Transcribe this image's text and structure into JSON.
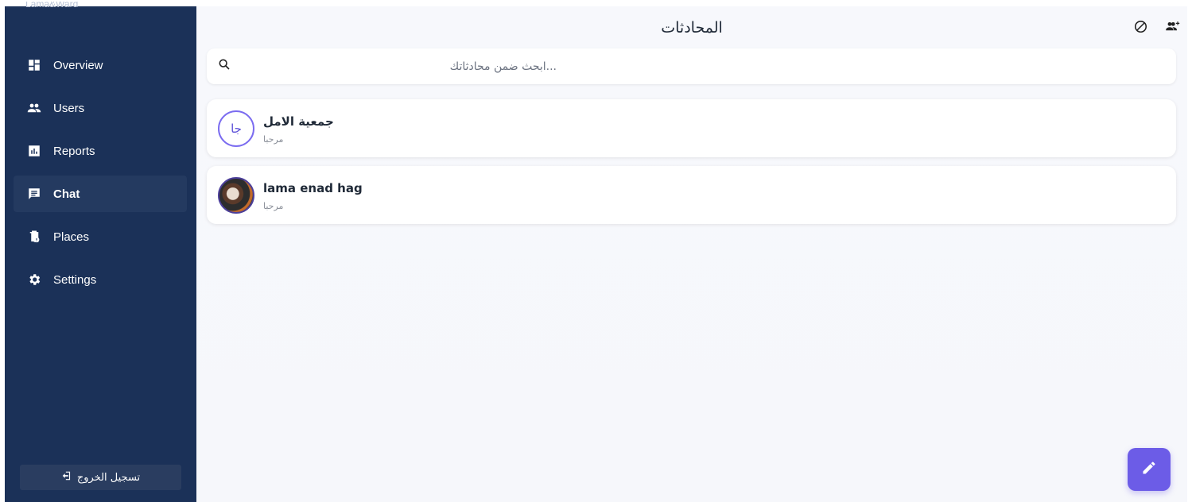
{
  "sidebar": {
    "brand": "Lama&Ward",
    "items": [
      {
        "label": "Overview",
        "icon": "dashboard-icon"
      },
      {
        "label": "Users",
        "icon": "users-icon"
      },
      {
        "label": "Reports",
        "icon": "reports-icon"
      },
      {
        "label": "Chat",
        "icon": "chat-icon",
        "active": true
      },
      {
        "label": "Places",
        "icon": "places-icon"
      },
      {
        "label": "Settings",
        "icon": "gear-icon"
      }
    ],
    "logout_label": "تسجيل الخروج"
  },
  "header": {
    "title": "المحادثات",
    "icons": [
      "block-icon",
      "add-user-icon"
    ]
  },
  "search": {
    "placeholder": "...ابحث ضمن محادثاتك"
  },
  "conversations": [
    {
      "name": "جمعية الامل",
      "preview": "مرحبا",
      "avatar_initials": "جا"
    },
    {
      "name": "lama enad hag",
      "preview": "مرحبا",
      "avatar": "photo"
    }
  ],
  "colors": {
    "sidebar_bg": "#1b3158",
    "accent": "#6c5ce7",
    "main_bg": "#f7f8fc"
  }
}
